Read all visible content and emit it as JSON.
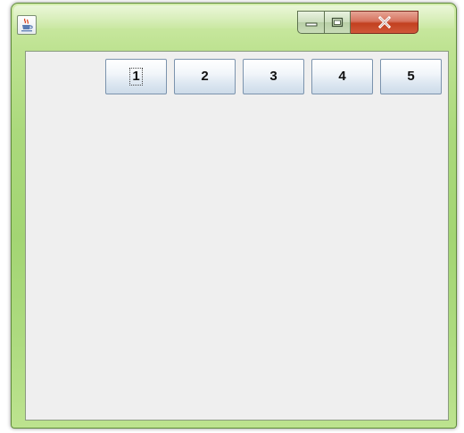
{
  "window": {
    "icon": "java-cup-icon",
    "caption_buttons": {
      "minimize_icon": "minimize-icon",
      "maximize_icon": "maximize-icon",
      "close_label": "X"
    }
  },
  "buttons": [
    {
      "label": "1",
      "focused": true
    },
    {
      "label": "2"
    },
    {
      "label": "3"
    },
    {
      "label": "4"
    },
    {
      "label": "5"
    }
  ],
  "colors": {
    "frame": "#a3d573",
    "content_bg": "#efefef",
    "close_button": "#c2401f",
    "button_border": "#7b93ad"
  }
}
